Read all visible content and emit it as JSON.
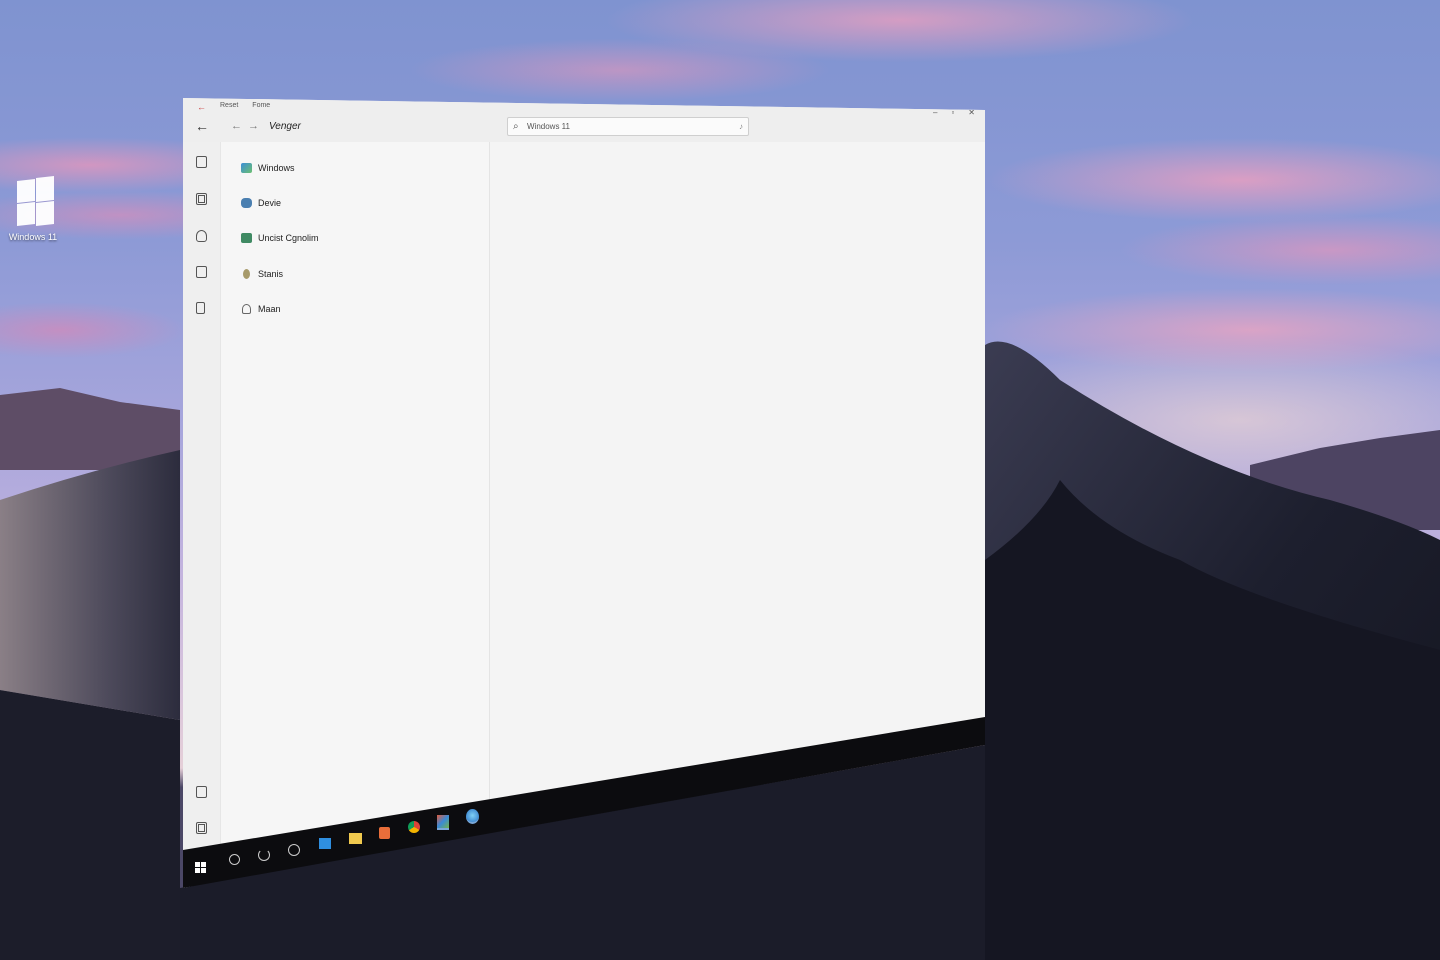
{
  "desktop": {
    "icon_label": "Windows 11"
  },
  "window": {
    "menu": [
      "Reset",
      "Fome"
    ],
    "breadcrumb": "Venger",
    "search": {
      "value": "Windows 11"
    },
    "controls": {
      "minimize": "–",
      "maximize": "▫",
      "close": "✕"
    },
    "rail_icons": [
      "window-icon",
      "grid-icon",
      "person-icon",
      "document-icon",
      "tablet-icon",
      "note-icon",
      "list-icon"
    ],
    "nav_items": [
      {
        "label": "Windows",
        "icon": "windows-app-icon",
        "color": "#3b8ed8"
      },
      {
        "label": "Devie",
        "icon": "device-icon",
        "color": "#4a7fb0"
      },
      {
        "label": "Uncist Cgnolim",
        "icon": "network-icon",
        "color": "#3f8a63"
      },
      {
        "label": "Stanis",
        "icon": "status-icon",
        "color": "#a79a6a"
      },
      {
        "label": "Maan",
        "icon": "home-icon",
        "color": "#666666"
      }
    ]
  },
  "taskbar": {
    "items": [
      "start-icon",
      "search-icon",
      "refresh-icon",
      "cortana-icon",
      "desktop-icon",
      "file-explorer-icon",
      "office-icon",
      "chrome-icon",
      "app-icon",
      "browser-icon"
    ]
  }
}
